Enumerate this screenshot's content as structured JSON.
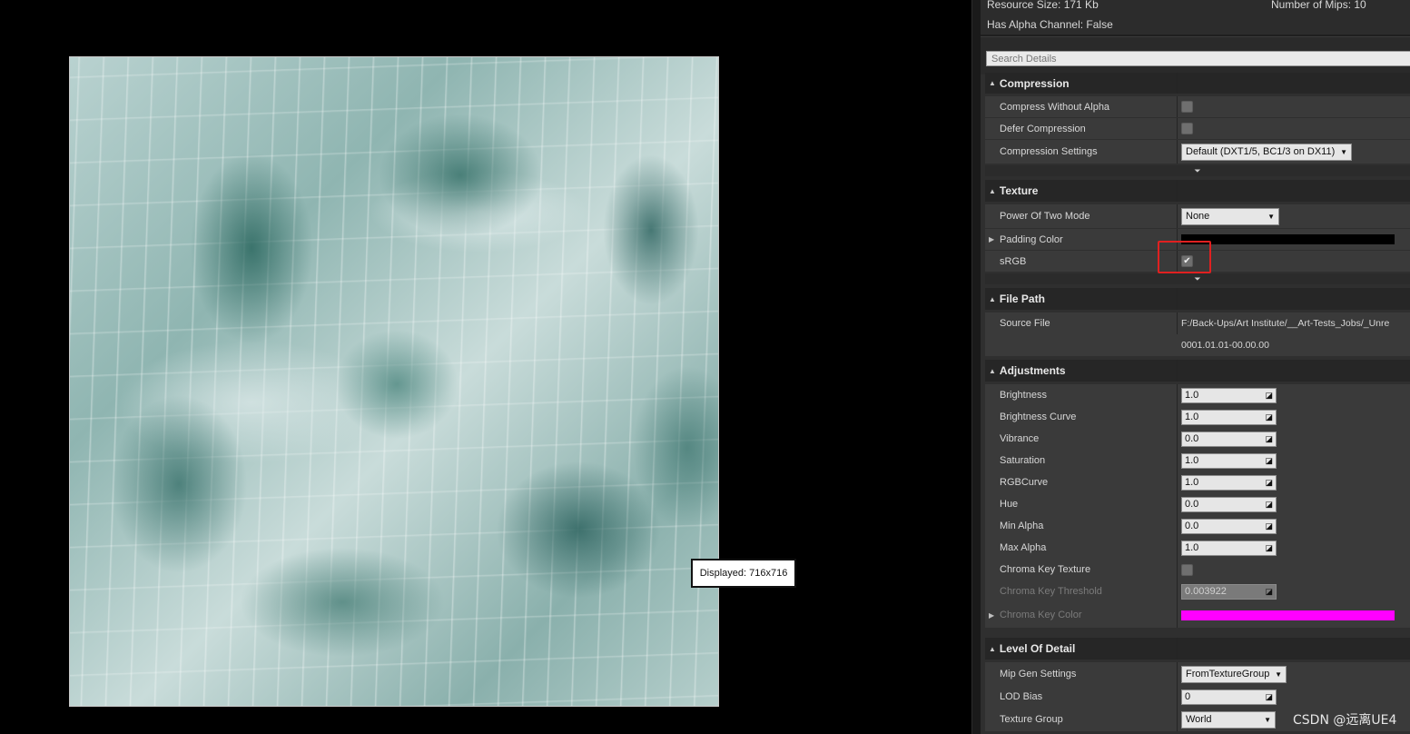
{
  "viewport": {
    "tooltip": "Displayed: 716x716"
  },
  "info": {
    "resource_size": "Resource Size: 171 Kb",
    "num_mips": "Number of Mips: 10",
    "has_alpha": "Has Alpha Channel: False"
  },
  "search": {
    "placeholder": "Search Details"
  },
  "compression": {
    "title": "Compression",
    "compress_without_alpha": "Compress Without Alpha",
    "defer_compression": "Defer Compression",
    "compression_settings": "Compression Settings",
    "compression_settings_value": "Default (DXT1/5, BC1/3 on DX11)"
  },
  "texture": {
    "title": "Texture",
    "power_of_two_mode": "Power Of Two Mode",
    "power_of_two_value": "None",
    "padding_color": "Padding Color",
    "padding_color_hex": "#000000",
    "srgb": "sRGB",
    "srgb_checked": "✔"
  },
  "file_path": {
    "title": "File Path",
    "source_file": "Source File",
    "source_file_value": "F:/Back-Ups/Art Institute/__Art-Tests_Jobs/_Unre",
    "timestamp": "0001.01.01-00.00.00"
  },
  "adjustments": {
    "title": "Adjustments",
    "brightness": "Brightness",
    "brightness_value": "1.0",
    "brightness_curve": "Brightness Curve",
    "brightness_curve_value": "1.0",
    "vibrance": "Vibrance",
    "vibrance_value": "0.0",
    "saturation": "Saturation",
    "saturation_value": "1.0",
    "rgbcurve": "RGBCurve",
    "rgbcurve_value": "1.0",
    "hue": "Hue",
    "hue_value": "0.0",
    "min_alpha": "Min Alpha",
    "min_alpha_value": "0.0",
    "max_alpha": "Max Alpha",
    "max_alpha_value": "1.0",
    "chroma_key_texture": "Chroma Key Texture",
    "chroma_key_threshold": "Chroma Key Threshold",
    "chroma_key_threshold_value": "0.003922",
    "chroma_key_color": "Chroma Key Color",
    "chroma_key_color_hex": "#ff00ff"
  },
  "lod": {
    "title": "Level Of Detail",
    "mip_gen_settings": "Mip Gen Settings",
    "mip_gen_value": "FromTextureGroup",
    "lod_bias": "LOD Bias",
    "lod_bias_value": "0",
    "texture_group": "Texture Group",
    "texture_group_value": "World"
  },
  "icons": {
    "collapse": "▲",
    "expand": "▶",
    "advanced": "⏷",
    "dropdown_arrow": "▼",
    "spin_grip": "◪"
  },
  "watermark": "CSDN @远离UE4"
}
